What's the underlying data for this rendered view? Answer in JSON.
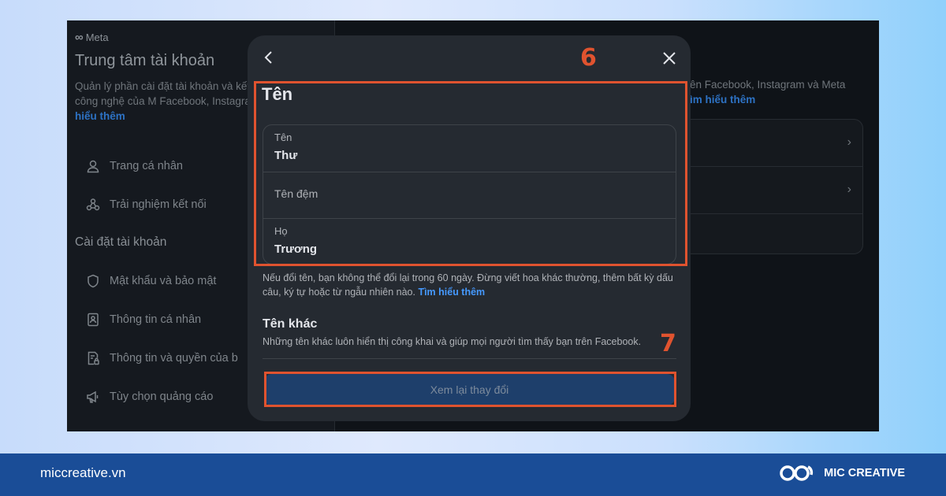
{
  "background": {
    "meta_logo": "Meta",
    "left_panel": {
      "title": "Trung tâm tài khoản",
      "description": "Quản lý phần cài đặt tài khoản và kết nối trên các công nghệ của M Facebook, Instagram và Meta Ho",
      "learn_more": "hiểu thêm",
      "items_top": [
        {
          "icon": "person-icon",
          "label": "Trang cá nhân"
        },
        {
          "icon": "connections-icon",
          "label": "Trải nghiệm kết nối"
        }
      ],
      "section_title": "Cài đặt tài khoản",
      "items_settings": [
        {
          "icon": "shield-icon",
          "label": "Mật khẩu và bảo mật"
        },
        {
          "icon": "id-card-icon",
          "label": "Thông tin cá nhân"
        },
        {
          "icon": "document-lock-icon",
          "label": "Thông tin và quyền của b"
        },
        {
          "icon": "megaphone-icon",
          "label": "Tùy chọn quảng cáo"
        }
      ]
    },
    "right_panel": {
      "description": "ên Facebook, Instagram và Meta",
      "learn_more": "ìm hiểu thêm"
    }
  },
  "modal": {
    "title": "Tên",
    "fields": [
      {
        "label": "Tên",
        "value": "Thư"
      },
      {
        "label": "Tên đệm",
        "value": ""
      },
      {
        "label": "Họ",
        "value": "Trương"
      }
    ],
    "notice": "Nếu đổi tên, bạn không thể đổi lại trong 60 ngày. Đừng viết hoa khác thường, thêm bất kỳ dấu câu, ký tự hoặc từ ngẫu nhiên nào.",
    "notice_link": "Tìm hiểu thêm",
    "other_names_title": "Tên khác",
    "other_names_desc": "Những tên khác luôn hiển thị công khai và giúp mọi người tìm thấy bạn trên Facebook.",
    "review_button": "Xem lại thay đổi"
  },
  "annotations": {
    "step_6": "6",
    "step_7": "7",
    "color": "#e0532f"
  },
  "footer": {
    "website": "miccreative.vn",
    "brand": "MIC CREATIVE",
    "background_color": "#1a4d97"
  }
}
